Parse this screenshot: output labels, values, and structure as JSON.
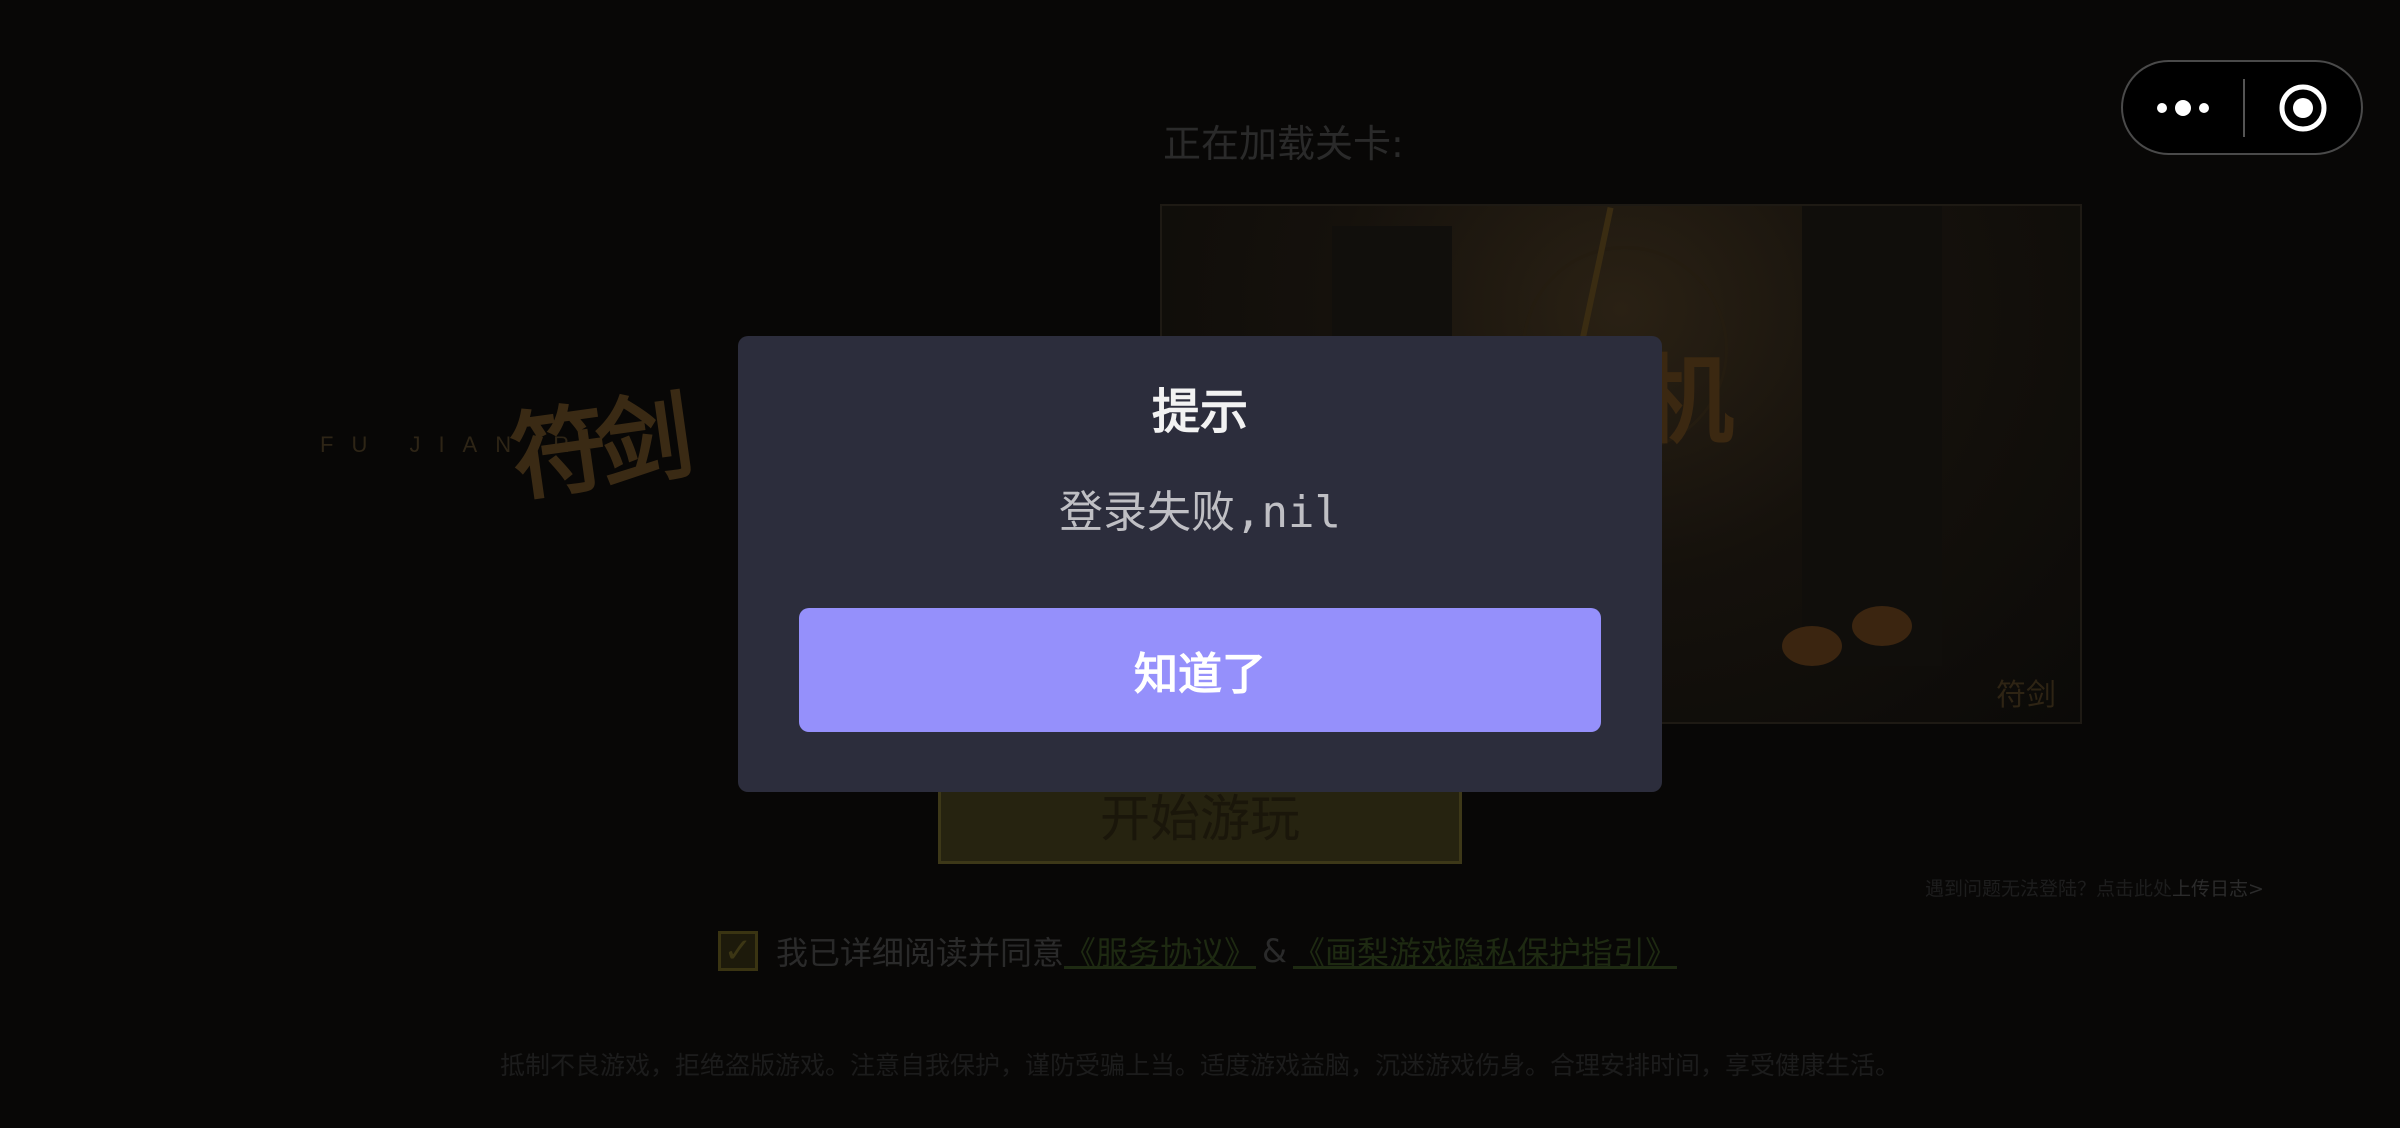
{
  "background": {
    "logo": {
      "letters": "FU  JIAN        R",
      "calligraphy": "符剑"
    },
    "loading_label": "正在加载关卡:",
    "preview_overlay_text": "挂机\n备",
    "preview_signature": "符剑",
    "start_button_label": "开始游玩",
    "report_link": {
      "prefix": "遇到问题无法登陆？点击此处",
      "action": "上传日志>"
    },
    "agreement": {
      "checked": true,
      "text": "我已详细阅读并同意",
      "service_link": "《服务协议》",
      "connector": "&",
      "privacy_link": "《画梨游戏隐私保护指引》"
    },
    "footer_note": "抵制不良游戏，拒绝盗版游戏。注意自我保护，谨防受骗上当。适度游戏益脑，沉迷游戏伤身。合理安排时间，享受健康生活。"
  },
  "capsule": {
    "more_icon": "more-dots-icon",
    "close_icon": "target-close-icon"
  },
  "dialog": {
    "title": "提示",
    "message": "登录失败,nil",
    "ok_label": "知道了",
    "accent_color": "#9590fb",
    "panel_color": "#2c2d3c"
  }
}
